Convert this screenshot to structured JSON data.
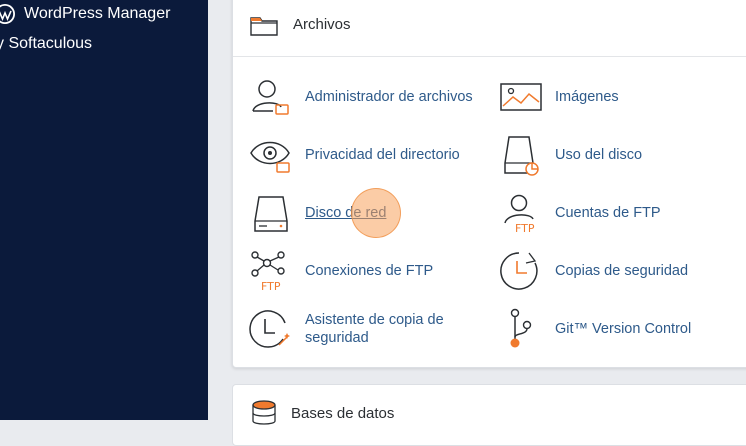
{
  "sidebar": {
    "items": [
      {
        "label": "WordPress Manager"
      },
      {
        "label": "y Softaculous"
      }
    ]
  },
  "files_panel": {
    "title": "Archivos",
    "tools": [
      {
        "label": "Administrador de archivos",
        "icon": "file-manager-icon"
      },
      {
        "label": "Imágenes",
        "icon": "images-icon"
      },
      {
        "label": "Privacidad del directorio",
        "icon": "directory-privacy-icon"
      },
      {
        "label": "Uso del disco",
        "icon": "disk-usage-icon"
      },
      {
        "label": "Disco de red",
        "icon": "network-disk-icon"
      },
      {
        "label": "Cuentas de FTP",
        "icon": "ftp-accounts-icon"
      },
      {
        "label": "Conexiones de FTP",
        "icon": "ftp-connections-icon"
      },
      {
        "label": "Copias de seguridad",
        "icon": "backup-icon"
      },
      {
        "label": "Asistente de copia de seguridad",
        "icon": "backup-wizard-icon"
      },
      {
        "label": "Git™ Version Control",
        "icon": "git-icon"
      }
    ]
  },
  "databases_panel": {
    "title": "Bases de datos"
  },
  "colors": {
    "sidebar": "#0b1a3b",
    "link": "#2e5a8a",
    "accent": "#f07a2e"
  }
}
